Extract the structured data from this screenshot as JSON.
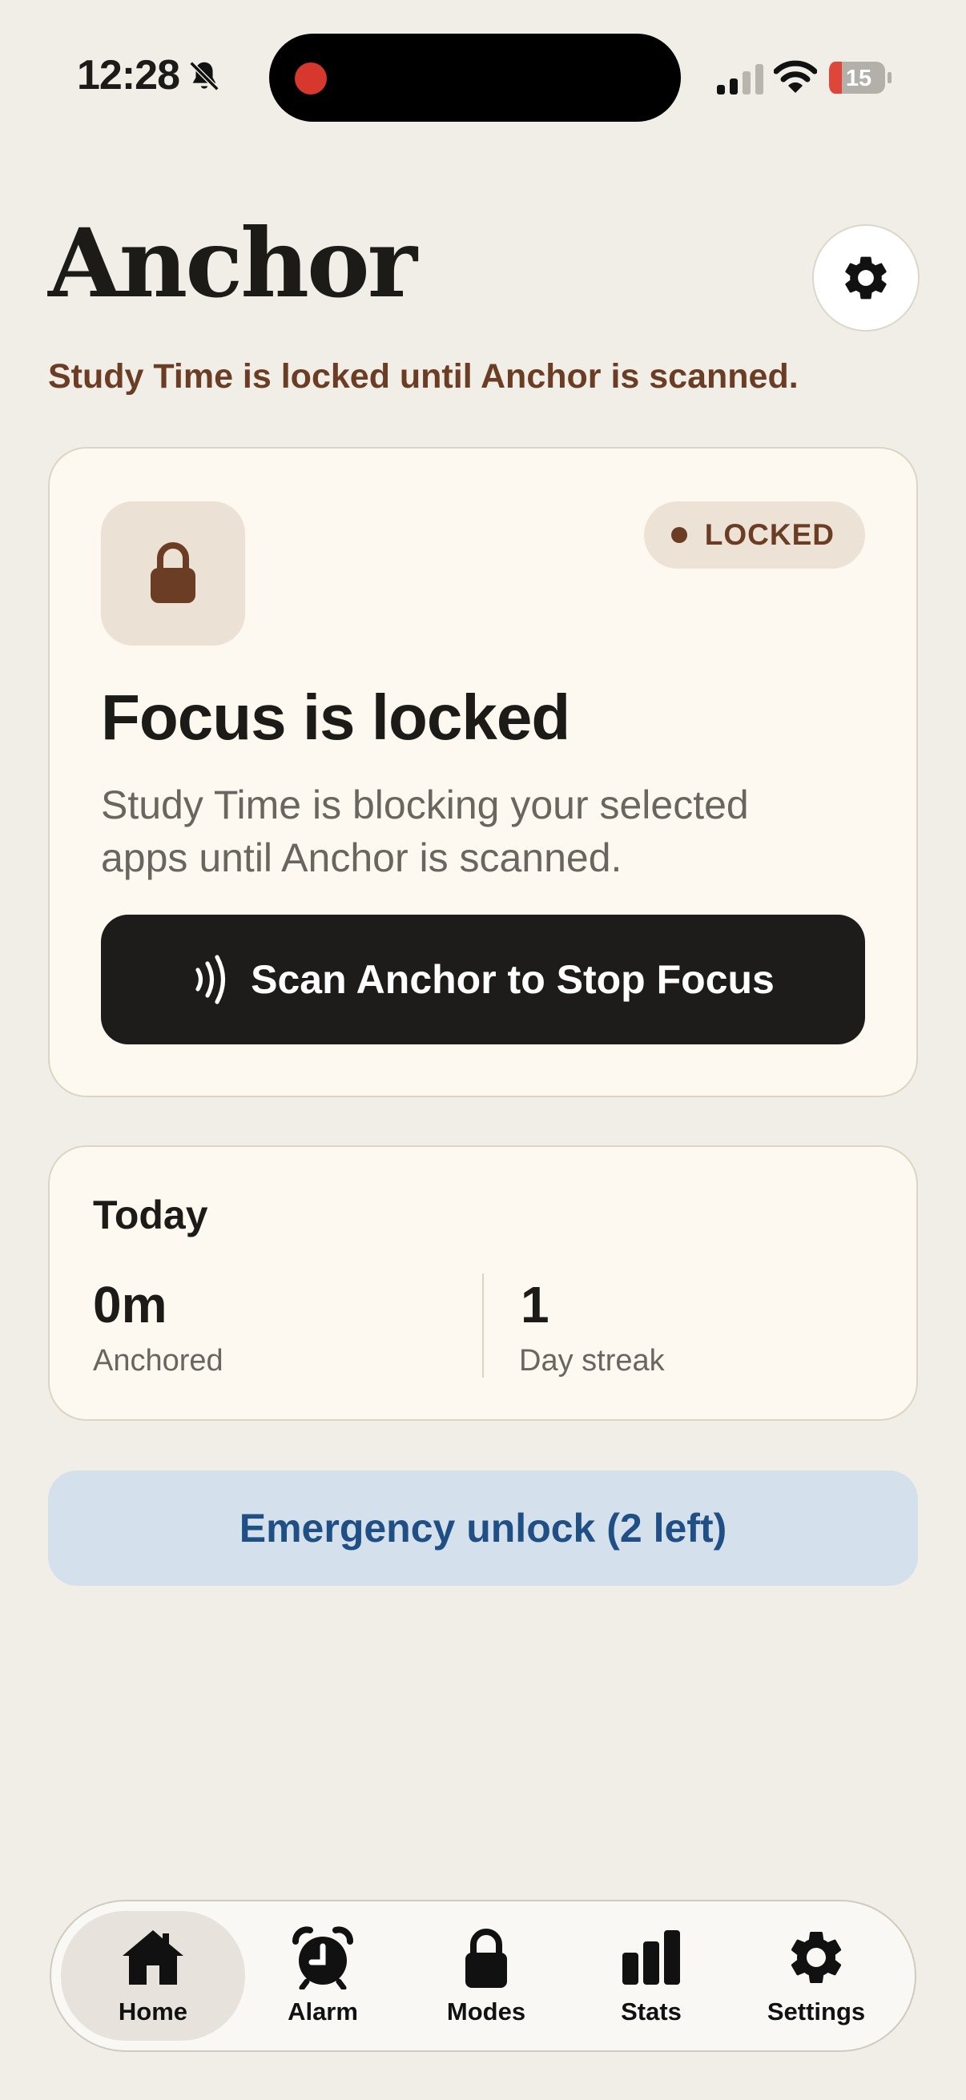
{
  "status_bar": {
    "time": "12:28",
    "battery": "15"
  },
  "header": {
    "title": "Anchor",
    "subtitle": "Study Time is locked until Anchor is scanned."
  },
  "main_card": {
    "badge": "LOCKED",
    "heading": "Focus is locked",
    "description": "Study Time is blocking your selected apps until Anchor is scanned.",
    "scan_button": "Scan Anchor to Stop Focus"
  },
  "today": {
    "title": "Today",
    "stats": [
      {
        "value": "0m",
        "label": "Anchored"
      },
      {
        "value": "1",
        "label": "Day streak"
      }
    ]
  },
  "emergency_button": "Emergency unlock (2 left)",
  "tabs": [
    {
      "label": "Home",
      "icon": "house-icon",
      "active": true
    },
    {
      "label": "Alarm",
      "icon": "alarm-clock-icon"
    },
    {
      "label": "Modes",
      "icon": "lock-icon"
    },
    {
      "label": "Stats",
      "icon": "bar-chart-icon"
    },
    {
      "label": "Settings",
      "icon": "gear-icon"
    }
  ],
  "colors": {
    "background": "#f1eee7",
    "accent_brown": "#6b3d25",
    "emergency_bg": "#d4e1ec",
    "emergency_text": "#1f4f84",
    "record_dot": "#d7382e",
    "battery_low": "#e0453a"
  }
}
